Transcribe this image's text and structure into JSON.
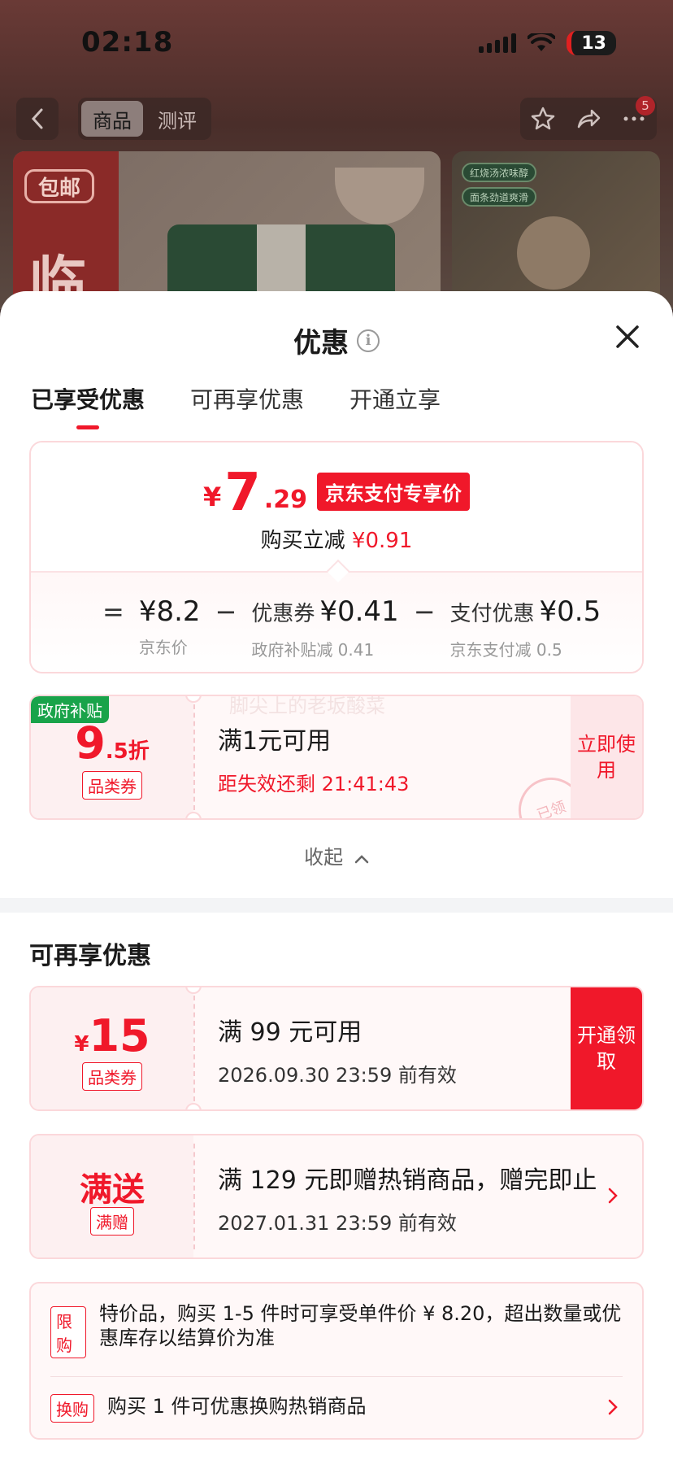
{
  "status_bar": {
    "time": "02:18",
    "battery": "13"
  },
  "top_nav": {
    "tabs": [
      "商品",
      "测评"
    ],
    "badge_count": "5"
  },
  "hero": {
    "left_badge": "包邮",
    "left_big_char": "临",
    "right_chips": [
      "红烧汤浓味醇",
      "面条劲道爽滑"
    ]
  },
  "sheet": {
    "title": "优惠",
    "tabs": [
      "已享受优惠",
      "可再享优惠",
      "开通立享"
    ],
    "price_card": {
      "currency": "¥",
      "price_int": "7",
      "price_dec": ".29",
      "price_tag": "京东支付专享价",
      "reduce_label": "购买立减",
      "reduce_amount": "¥0.91",
      "breakdown": {
        "eq": "=",
        "minus": "−",
        "jd_price_value": "¥8.2",
        "jd_price_label": "京东价",
        "coupon_label": "优惠券",
        "coupon_value": "¥0.41",
        "coupon_sub": "政府补贴减 0.41",
        "pay_label": "支付优惠",
        "pay_value": "¥0.5",
        "pay_sub": "京东支付减 0.5"
      }
    },
    "coupon1": {
      "gov_tag": "政府补贴",
      "discount_big": "9",
      "discount_small": ".5折",
      "type_tag": "品类券",
      "condition": "满1元可用",
      "countdown": "距失效还剩 21:41:43",
      "button": "立即使用",
      "stamp": "已领",
      "watermark": "脚尖上的老坂酸菜"
    },
    "collapse_label": "收起",
    "section_title": "可再享优惠",
    "coupon2": {
      "currency": "¥",
      "amount": "15",
      "type_tag": "品类券",
      "condition": "满 99 元可用",
      "validity": "2026.09.30 23:59 前有效",
      "button": "开通领取"
    },
    "coupon3": {
      "title": "满送",
      "type_tag": "满赠",
      "condition": "满 129 元即赠热销商品，赠完即止",
      "validity": "2027.01.31 23:59 前有效"
    },
    "rules": [
      {
        "tag": "限购",
        "text": "特价品，购买 1-5 件时可享受单件价 ¥ 8.20，超出数量或优惠库存以结算价为准"
      },
      {
        "tag": "换购",
        "text": "购买 1 件可优惠换购热销商品"
      }
    ]
  },
  "colors": {
    "accent": "#f0182a",
    "gov_green": "#19a34a"
  }
}
